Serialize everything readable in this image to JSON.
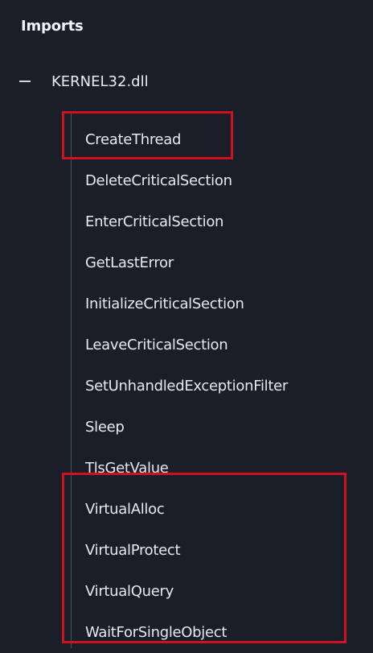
{
  "panel": {
    "title": "Imports",
    "dll": {
      "name": "KERNEL32.dll",
      "toggle_icon": "collapse-icon"
    },
    "functions": [
      "CreateThread",
      "DeleteCriticalSection",
      "EnterCriticalSection",
      "GetLastError",
      "InitializeCriticalSection",
      "LeaveCriticalSection",
      "SetUnhandledExceptionFilter",
      "Sleep",
      "TlsGetValue",
      "VirtualAlloc",
      "VirtualProtect",
      "VirtualQuery",
      "WaitForSingleObject"
    ]
  },
  "colors": {
    "background": "#1a1e29",
    "text": "#e6e9f0",
    "highlight_box": "#d0111f"
  }
}
